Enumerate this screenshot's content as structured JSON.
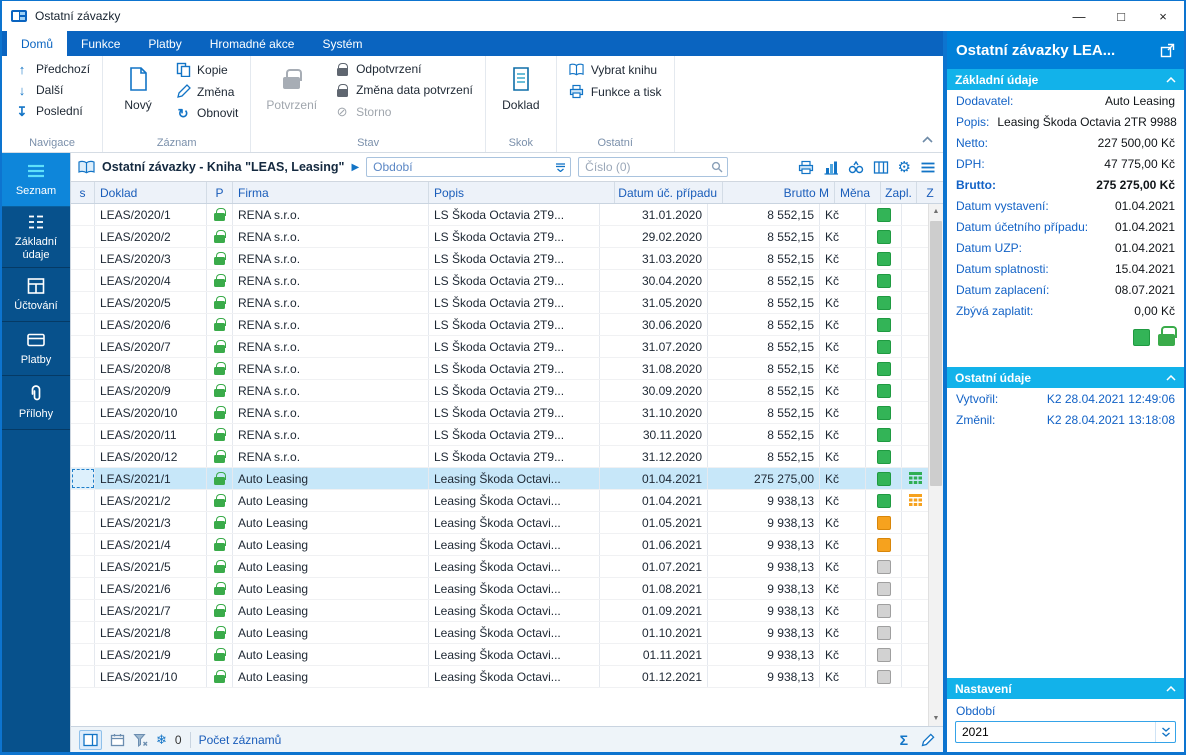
{
  "window": {
    "title": "Ostatní závazky",
    "minimize": "—",
    "maximize": "□",
    "close": "×"
  },
  "icons": {
    "scroll_up": "▲",
    "scroll_down": "▼",
    "sum": "Σ",
    "snowflake": "❄",
    "gear": "⚙",
    "expander": "▶"
  },
  "ribbon": {
    "tabs": [
      {
        "label": "Domů",
        "state": "active"
      },
      {
        "label": "Funkce",
        "state": ""
      },
      {
        "label": "Platby",
        "state": ""
      },
      {
        "label": "Hromadné akce",
        "state": ""
      },
      {
        "label": "Systém",
        "state": ""
      }
    ],
    "navigace": {
      "caption": "Navigace",
      "items": [
        {
          "label": "Předchozí",
          "icon": "↑"
        },
        {
          "label": "Další",
          "icon": "↓"
        },
        {
          "label": "Poslední",
          "icon": "↧"
        }
      ]
    },
    "zaznam": {
      "caption": "Záznam",
      "big": "Nový",
      "kopie": "Kopie",
      "zmena": "Změna",
      "obnovit": "Obnovit",
      "obnovit_icon": "↻"
    },
    "stav": {
      "caption": "Stav",
      "big": "Potvrzení",
      "odpotvrzeni": "Odpotvrzení",
      "zmena_data": "Změna data potvrzení",
      "storno": "Storno",
      "storno_icon": "⊘"
    },
    "skok": {
      "caption": "Skok",
      "big": "Doklad"
    },
    "ostatni": {
      "caption": "Ostatní",
      "vybrat": "Vybrat knihu",
      "funkce": "Funkce a tisk"
    }
  },
  "sidebar": {
    "items": [
      {
        "label": "Seznam",
        "state": "active"
      },
      {
        "label": "Základní údaje",
        "state": ""
      },
      {
        "label": "Účtování",
        "state": ""
      },
      {
        "label": "Platby",
        "state": ""
      },
      {
        "label": "Přílohy",
        "state": ""
      }
    ]
  },
  "table": {
    "title": "Ostatní závazky - Kniha \"LEAS, Leasing\"",
    "filter_obdobi": "Období",
    "filter_cislo": "Číslo (0)",
    "columns": {
      "s": "s",
      "doklad": "Doklad",
      "p": "P",
      "firma": "Firma",
      "popis": "Popis",
      "datum": "Datum úč. případu",
      "brutto": "Brutto M",
      "mena": "Měna",
      "zapl": "Zapl.",
      "z": "Z"
    },
    "rows": [
      {
        "state": "",
        "doklad": "LEAS/2020/1",
        "firma": "RENA s.r.o.",
        "popis": "LS Škoda Octavia 2T9...",
        "datum": "31.01.2020",
        "brutto": "8 552,15",
        "mena": "Kč",
        "zapl": "green",
        "z": ""
      },
      {
        "state": "",
        "doklad": "LEAS/2020/2",
        "firma": "RENA s.r.o.",
        "popis": "LS Škoda Octavia 2T9...",
        "datum": "29.02.2020",
        "brutto": "8 552,15",
        "mena": "Kč",
        "zapl": "green",
        "z": ""
      },
      {
        "state": "",
        "doklad": "LEAS/2020/3",
        "firma": "RENA s.r.o.",
        "popis": "LS Škoda Octavia 2T9...",
        "datum": "31.03.2020",
        "brutto": "8 552,15",
        "mena": "Kč",
        "zapl": "green",
        "z": ""
      },
      {
        "state": "",
        "doklad": "LEAS/2020/4",
        "firma": "RENA s.r.o.",
        "popis": "LS Škoda Octavia 2T9...",
        "datum": "30.04.2020",
        "brutto": "8 552,15",
        "mena": "Kč",
        "zapl": "green",
        "z": ""
      },
      {
        "state": "",
        "doklad": "LEAS/2020/5",
        "firma": "RENA s.r.o.",
        "popis": "LS Škoda Octavia 2T9...",
        "datum": "31.05.2020",
        "brutto": "8 552,15",
        "mena": "Kč",
        "zapl": "green",
        "z": ""
      },
      {
        "state": "",
        "doklad": "LEAS/2020/6",
        "firma": "RENA s.r.o.",
        "popis": "LS Škoda Octavia 2T9...",
        "datum": "30.06.2020",
        "brutto": "8 552,15",
        "mena": "Kč",
        "zapl": "green",
        "z": ""
      },
      {
        "state": "",
        "doklad": "LEAS/2020/7",
        "firma": "RENA s.r.o.",
        "popis": "LS Škoda Octavia 2T9...",
        "datum": "31.07.2020",
        "brutto": "8 552,15",
        "mena": "Kč",
        "zapl": "green",
        "z": ""
      },
      {
        "state": "",
        "doklad": "LEAS/2020/8",
        "firma": "RENA s.r.o.",
        "popis": "LS Škoda Octavia 2T9...",
        "datum": "31.08.2020",
        "brutto": "8 552,15",
        "mena": "Kč",
        "zapl": "green",
        "z": ""
      },
      {
        "state": "",
        "doklad": "LEAS/2020/9",
        "firma": "RENA s.r.o.",
        "popis": "LS Škoda Octavia 2T9...",
        "datum": "30.09.2020",
        "brutto": "8 552,15",
        "mena": "Kč",
        "zapl": "green",
        "z": ""
      },
      {
        "state": "",
        "doklad": "LEAS/2020/10",
        "firma": "RENA s.r.o.",
        "popis": "LS Škoda Octavia 2T9...",
        "datum": "31.10.2020",
        "brutto": "8 552,15",
        "mena": "Kč",
        "zapl": "green",
        "z": ""
      },
      {
        "state": "",
        "doklad": "LEAS/2020/11",
        "firma": "RENA s.r.o.",
        "popis": "LS Škoda Octavia 2T9...",
        "datum": "30.11.2020",
        "brutto": "8 552,15",
        "mena": "Kč",
        "zapl": "green",
        "z": ""
      },
      {
        "state": "",
        "doklad": "LEAS/2020/12",
        "firma": "RENA s.r.o.",
        "popis": "LS Škoda Octavia 2T9...",
        "datum": "31.12.2020",
        "brutto": "8 552,15",
        "mena": "Kč",
        "zapl": "green",
        "z": ""
      },
      {
        "state": "selected",
        "doklad": "LEAS/2021/1",
        "firma": "Auto Leasing",
        "popis": "Leasing Škoda Octavi...",
        "datum": "01.04.2021",
        "brutto": "275 275,00",
        "mena": "Kč",
        "zapl": "green",
        "z": "grid"
      },
      {
        "state": "",
        "doklad": "LEAS/2021/2",
        "firma": "Auto Leasing",
        "popis": "Leasing Škoda Octavi...",
        "datum": "01.04.2021",
        "brutto": "9 938,13",
        "mena": "Kč",
        "zapl": "green",
        "z": "calc"
      },
      {
        "state": "",
        "doklad": "LEAS/2021/3",
        "firma": "Auto Leasing",
        "popis": "Leasing Škoda Octavi...",
        "datum": "01.05.2021",
        "brutto": "9 938,13",
        "mena": "Kč",
        "zapl": "orange",
        "z": ""
      },
      {
        "state": "",
        "doklad": "LEAS/2021/4",
        "firma": "Auto Leasing",
        "popis": "Leasing Škoda Octavi...",
        "datum": "01.06.2021",
        "brutto": "9 938,13",
        "mena": "Kč",
        "zapl": "orange",
        "z": ""
      },
      {
        "state": "",
        "doklad": "LEAS/2021/5",
        "firma": "Auto Leasing",
        "popis": "Leasing Škoda Octavi...",
        "datum": "01.07.2021",
        "brutto": "9 938,13",
        "mena": "Kč",
        "zapl": "gray",
        "z": ""
      },
      {
        "state": "",
        "doklad": "LEAS/2021/6",
        "firma": "Auto Leasing",
        "popis": "Leasing Škoda Octavi...",
        "datum": "01.08.2021",
        "brutto": "9 938,13",
        "mena": "Kč",
        "zapl": "gray",
        "z": ""
      },
      {
        "state": "",
        "doklad": "LEAS/2021/7",
        "firma": "Auto Leasing",
        "popis": "Leasing Škoda Octavi...",
        "datum": "01.09.2021",
        "brutto": "9 938,13",
        "mena": "Kč",
        "zapl": "gray",
        "z": ""
      },
      {
        "state": "",
        "doklad": "LEAS/2021/8",
        "firma": "Auto Leasing",
        "popis": "Leasing Škoda Octavi...",
        "datum": "01.10.2021",
        "brutto": "9 938,13",
        "mena": "Kč",
        "zapl": "gray",
        "z": ""
      },
      {
        "state": "",
        "doklad": "LEAS/2021/9",
        "firma": "Auto Leasing",
        "popis": "Leasing Škoda Octavi...",
        "datum": "01.11.2021",
        "brutto": "9 938,13",
        "mena": "Kč",
        "zapl": "gray",
        "z": ""
      },
      {
        "state": "",
        "doklad": "LEAS/2021/10",
        "firma": "Auto Leasing",
        "popis": "Leasing Škoda Octavi...",
        "datum": "01.12.2021",
        "brutto": "9 938,13",
        "mena": "Kč",
        "zapl": "gray",
        "z": ""
      }
    ],
    "footer": {
      "count": "0",
      "label": "Počet záznamů"
    }
  },
  "detail": {
    "title": "Ostatní závazky LEA...",
    "zakladni": {
      "header": "Základní údaje",
      "fields": [
        {
          "label": "Dodavatel:",
          "value": "Auto Leasing",
          "style": ""
        },
        {
          "label": "Popis:",
          "value": "Leasing Škoda Octavia 2TR 9988",
          "style": ""
        },
        {
          "label": "Netto:",
          "value": "227 500,00 Kč",
          "style": ""
        },
        {
          "label": "DPH:",
          "value": "47 775,00 Kč",
          "style": ""
        },
        {
          "label": "Brutto:",
          "value": "275 275,00 Kč",
          "style": "bold"
        },
        {
          "label": "Datum vystavení:",
          "value": "01.04.2021",
          "style": ""
        },
        {
          "label": "Datum účetního případu:",
          "value": "01.04.2021",
          "style": ""
        },
        {
          "label": "Datum UZP:",
          "value": "01.04.2021",
          "style": ""
        },
        {
          "label": "Datum splatnosti:",
          "value": "15.04.2021",
          "style": ""
        },
        {
          "label": "Datum zaplacení:",
          "value": "08.07.2021",
          "style": ""
        },
        {
          "label": "Zbývá zaplatit:",
          "value": "0,00 Kč",
          "style": ""
        }
      ]
    },
    "ostatni": {
      "header": "Ostatní údaje",
      "fields": [
        {
          "label": "Vytvořil:",
          "value": "K2 28.04.2021 12:49:06",
          "style": ""
        },
        {
          "label": "Změnil:",
          "value": "K2 28.04.2021 13:18:08",
          "style": ""
        }
      ]
    },
    "nastaveni": {
      "header": "Nastavení",
      "obdobi_label": "Období",
      "obdobi_value": "2021"
    }
  }
}
